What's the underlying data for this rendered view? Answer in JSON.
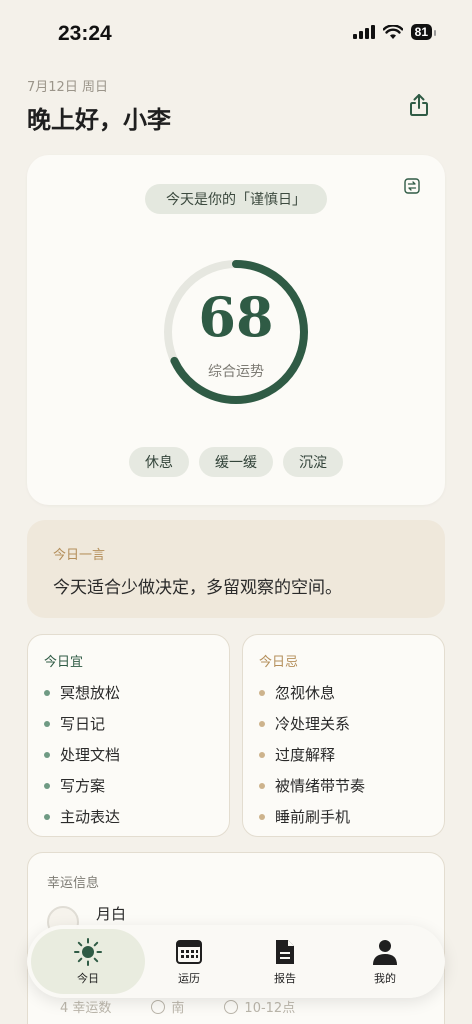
{
  "status": {
    "time": "23:24",
    "battery": "81"
  },
  "header": {
    "date": "7月12日 周日",
    "greeting": "晚上好，小李"
  },
  "main": {
    "day_label": "今天是你的「谨慎日」",
    "score": "68",
    "score_label": "综合运势",
    "score_progress": 0.68,
    "tags": [
      "休息",
      "缓一缓",
      "沉淀"
    ]
  },
  "quote": {
    "label": "今日一言",
    "text": "今天适合少做决定，多留观察的空间。"
  },
  "do_list": {
    "title": "今日宜",
    "items": [
      "冥想放松",
      "写日记",
      "处理文档",
      "写方案",
      "主动表达"
    ]
  },
  "dont_list": {
    "title": "今日忌",
    "items": [
      "忽视休息",
      "冷处理关系",
      "过度解释",
      "被情绪带节奏",
      "睡前刷手机"
    ]
  },
  "lucky": {
    "title": "幸运信息",
    "color_name": "月白",
    "number": "4 幸运数",
    "direction": "南",
    "time": "10-12点"
  },
  "tabs": [
    "今日",
    "运历",
    "报告",
    "我的"
  ],
  "colors": {
    "accent": "#2f5b45",
    "background": "#f4f1ea",
    "card": "#fcfbf7",
    "gold": "#b48f5b"
  }
}
